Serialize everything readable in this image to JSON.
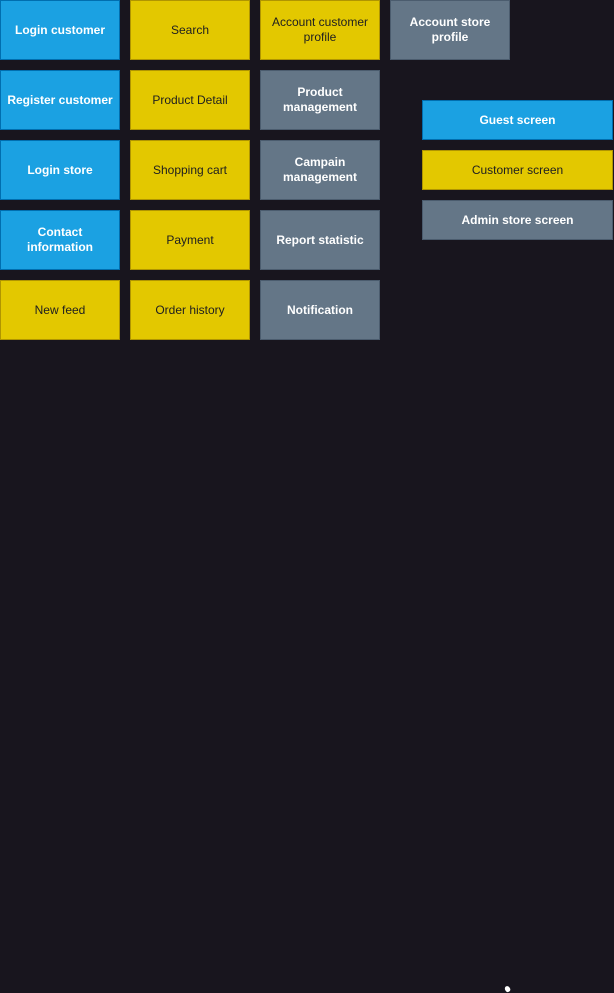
{
  "screens": {
    "guest": {
      "login_customer": "Login customer",
      "register_customer": "Register customer",
      "login_store": "Login store",
      "contact_information": "Contact information"
    },
    "customer": {
      "new_feed": "New feed",
      "search": "Search",
      "product_detail": "Product Detail",
      "shopping_cart": "Shopping cart",
      "payment": "Payment",
      "order_history": "Order history",
      "account_customer_profile": "Account customer profile"
    },
    "admin": {
      "product_management": "Product management",
      "campain_management": "Campain management",
      "report_statistic": "Report statistic",
      "notification": "Notification",
      "account_store_profile": "Account store profile"
    }
  },
  "legend": {
    "guest": "Guest screen",
    "customer": "Customer screen",
    "admin": "Admin store screen"
  },
  "colors": {
    "guest_fill": "#1ba1e2",
    "customer_fill": "#e3c800",
    "admin_fill": "#647687",
    "background": "#18151e"
  }
}
